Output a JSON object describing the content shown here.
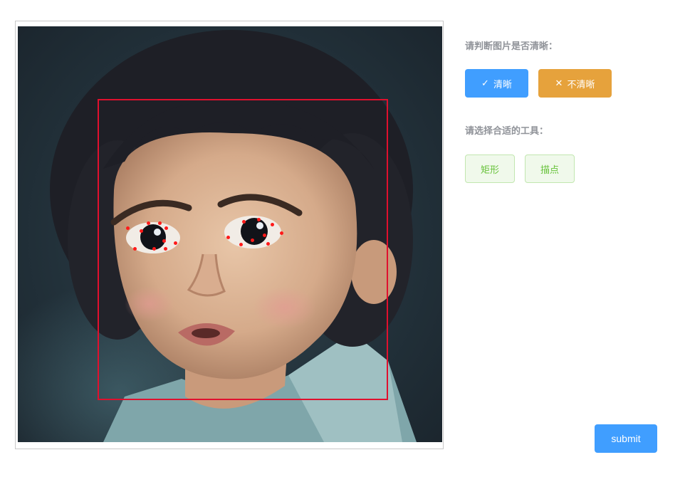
{
  "clarity_question": "请判断图片是否清晰：",
  "clear_button": {
    "label": "清晰",
    "icon": "check-icon",
    "color": "#409eff"
  },
  "unclear_button": {
    "label": "不清晰",
    "icon": "close-icon",
    "color": "#e6a23c"
  },
  "tool_question": "请选择合适的工具：",
  "tools": [
    {
      "label": "矩形"
    },
    {
      "label": "描点"
    }
  ],
  "submit_label": "submit",
  "annotation": {
    "shape": "rectangle",
    "box_color": "#e0102e",
    "landmark_color": "#ff1a1a"
  }
}
